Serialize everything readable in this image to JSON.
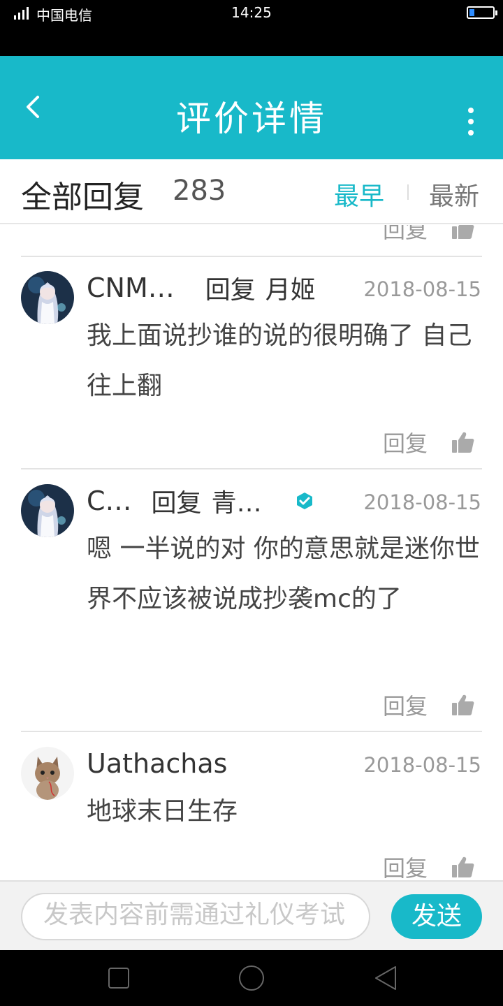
{
  "status_bar": {
    "network": "4G",
    "carrier": "中国电信",
    "time": "14:25"
  },
  "header": {
    "title": "评价详情"
  },
  "sort_bar": {
    "label": "全部回复",
    "count": "283",
    "earliest_label": "最早",
    "latest_label": "最新",
    "active": "最早"
  },
  "comments": [
    {
      "author": "CNM…",
      "reply_word": "回复",
      "reply_to": "月姬",
      "date": "2018-08-15",
      "body": "我上面说抄谁的说的很明确了 自己往上翻",
      "reply_label": "回复",
      "avatar": "anime-girl-avatar"
    },
    {
      "author": "C…",
      "reply_word": "回复",
      "reply_to": "青…",
      "date": "2018-08-15",
      "body": "嗯 一半说的对 你的意思就是迷你世界不应该被说成抄袭mc的了",
      "reply_label": "回复",
      "avatar": "anime-girl-avatar",
      "verified": true
    },
    {
      "author": "Uathachas",
      "date": "2018-08-15",
      "body": "地球末日生存",
      "reply_label": "回复",
      "avatar": "kitten-avatar"
    }
  ],
  "partial_comment": {
    "reply_label": "回复"
  },
  "composer": {
    "placeholder": "发表内容前需通过礼仪考试",
    "send_label": "发送"
  },
  "colors": {
    "accent": "#18b9c9",
    "status_bar": "#000000"
  },
  "icons": [
    "signal-icon",
    "battery-icon",
    "back-arrow-icon",
    "more-menu-icon",
    "like-icon",
    "verified-badge-icon",
    "nav-recent-apps-icon",
    "nav-home-icon",
    "nav-back-icon"
  ]
}
